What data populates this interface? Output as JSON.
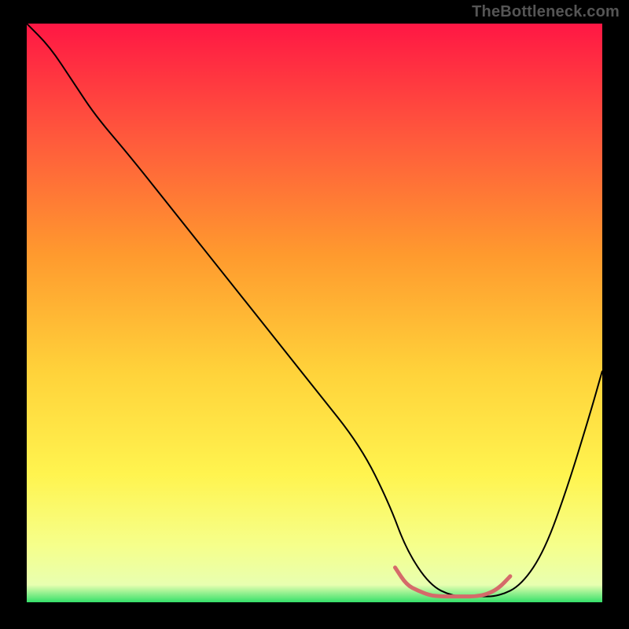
{
  "watermark": "TheBottleneck.com",
  "chart_data": {
    "type": "line",
    "title": "",
    "xlabel": "",
    "ylabel": "",
    "xlim": [
      0,
      100
    ],
    "ylim": [
      0,
      100
    ],
    "grid": false,
    "legend": false,
    "background_gradient": {
      "direction": "vertical",
      "stops": [
        {
          "offset": 0.0,
          "color": "#ff1744"
        },
        {
          "offset": 0.2,
          "color": "#ff5a3c"
        },
        {
          "offset": 0.4,
          "color": "#ff9a2e"
        },
        {
          "offset": 0.6,
          "color": "#ffd23a"
        },
        {
          "offset": 0.78,
          "color": "#fff44f"
        },
        {
          "offset": 0.9,
          "color": "#f6ff8a"
        },
        {
          "offset": 0.97,
          "color": "#e8ffb0"
        },
        {
          "offset": 1.0,
          "color": "#35e06a"
        }
      ]
    },
    "series": [
      {
        "name": "main-curve",
        "color": "#000000",
        "width": 2,
        "x": [
          0,
          4,
          8,
          12,
          18,
          26,
          34,
          42,
          50,
          58,
          63,
          66,
          70,
          74,
          78,
          82,
          86,
          90,
          94,
          98,
          100
        ],
        "y": [
          100,
          96,
          90,
          84,
          77,
          67,
          57,
          47,
          37,
          27,
          17,
          9,
          3,
          1,
          1,
          1,
          3,
          9,
          20,
          33,
          40
        ]
      },
      {
        "name": "optimal-zone",
        "color": "#d56a6a",
        "width": 5,
        "x": [
          64,
          66,
          68,
          70,
          72,
          74,
          76,
          78,
          80,
          82,
          84
        ],
        "y": [
          6,
          3,
          2,
          1.2,
          1,
          1,
          1,
          1,
          1.4,
          2.4,
          4.5
        ]
      }
    ]
  }
}
